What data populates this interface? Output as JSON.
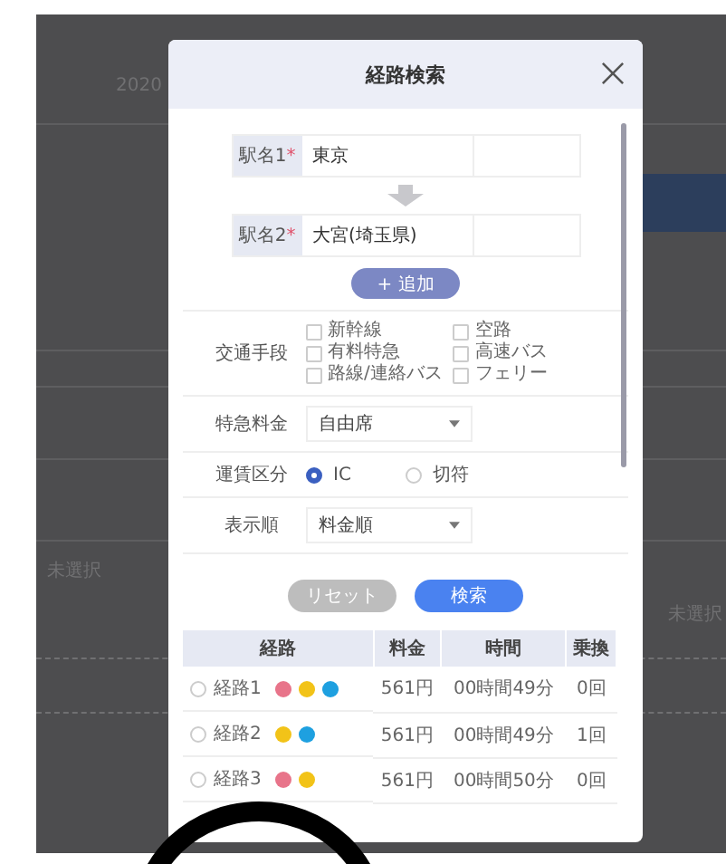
{
  "background": {
    "texts": [
      "2020",
      "未選択",
      "未選択"
    ]
  },
  "dialog": {
    "title": "経路検索",
    "stations": [
      {
        "label": "駅名1",
        "required_mark": "*",
        "value": "東京"
      },
      {
        "label": "駅名2",
        "required_mark": "*",
        "value": "大宮(埼玉県)"
      }
    ],
    "add_button": "+ 追加",
    "transport": {
      "label": "交通手段",
      "options": [
        {
          "label": "新幹線",
          "checked": false
        },
        {
          "label": "有料特急",
          "checked": false
        },
        {
          "label": "路線/連絡バス",
          "checked": false
        },
        {
          "label": "空路",
          "checked": false
        },
        {
          "label": "高速バス",
          "checked": false
        },
        {
          "label": "フェリー",
          "checked": false
        }
      ]
    },
    "express_fee": {
      "label": "特急料金",
      "value": "自由席"
    },
    "fare_type": {
      "label": "運賃区分",
      "options": [
        {
          "label": "IC",
          "selected": true
        },
        {
          "label": "切符",
          "selected": false
        }
      ]
    },
    "sort_order": {
      "label": "表示順",
      "value": "料金順"
    },
    "buttons": [
      {
        "label": "リセット",
        "disabled": true
      },
      {
        "label": "検索",
        "disabled": false
      }
    ],
    "table": {
      "columns": [
        "経路",
        "料金",
        "時間",
        "乗換"
      ],
      "rows": [
        {
          "selected": false,
          "route": "経路1",
          "lines": [
            {
              "color": "#e8748a"
            },
            {
              "color": "#f2c318"
            },
            {
              "color": "#1ea0e0"
            }
          ],
          "fare": "561円",
          "time": "00時間49分",
          "transfers": "0回"
        },
        {
          "selected": false,
          "route": "経路2",
          "lines": [
            {
              "color": "#f2c318"
            },
            {
              "color": "#1ea0e0"
            }
          ],
          "fare": "561円",
          "time": "00時間49分",
          "transfers": "1回"
        },
        {
          "selected": false,
          "route": "経路3",
          "lines": [
            {
              "color": "#e8748a"
            },
            {
              "color": "#f2c318"
            }
          ],
          "fare": "561円",
          "time": "00時間50分",
          "transfers": "0回"
        }
      ]
    }
  }
}
